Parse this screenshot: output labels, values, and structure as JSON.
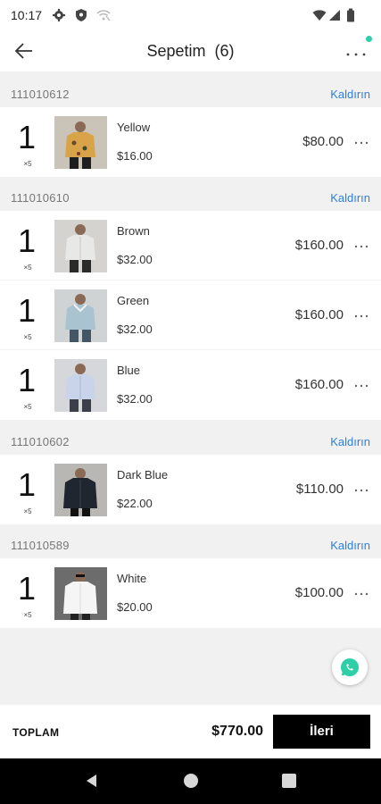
{
  "status_bar": {
    "time": "10:17",
    "icons_left": [
      "gear-icon",
      "shield-icon",
      "wifi-off-icon"
    ],
    "icons_right": [
      "wifi-icon",
      "signal-icon",
      "battery-icon"
    ]
  },
  "header": {
    "title": "Sepetim",
    "count": "(6)",
    "notification_color": "#2ecfa8"
  },
  "colors": {
    "accent_link": "#2f7fe0",
    "button_bg": "#000000",
    "background": "#f1f1f1"
  },
  "groups": [
    {
      "code": "111010612",
      "remove_label": "Kaldırın",
      "items": [
        {
          "qty": "1",
          "qty_sub": "×5",
          "name": "Yellow",
          "unit_price": "$16.00",
          "total": "$80.00",
          "shirt_color": "#d9a34a"
        }
      ]
    },
    {
      "code": "111010610",
      "remove_label": "Kaldırın",
      "items": [
        {
          "qty": "1",
          "qty_sub": "×5",
          "name": "Brown",
          "unit_price": "$32.00",
          "total": "$160.00",
          "shirt_color": "#e8e8e6"
        },
        {
          "qty": "1",
          "qty_sub": "×5",
          "name": "Green",
          "unit_price": "$32.00",
          "total": "$160.00",
          "shirt_color": "#a9c3d0"
        },
        {
          "qty": "1",
          "qty_sub": "×5",
          "name": "Blue",
          "unit_price": "$32.00",
          "total": "$160.00",
          "shirt_color": "#c9d4ea"
        }
      ]
    },
    {
      "code": "111010602",
      "remove_label": "Kaldırın",
      "items": [
        {
          "qty": "1",
          "qty_sub": "×5",
          "name": "Dark Blue",
          "unit_price": "$22.00",
          "total": "$110.00",
          "shirt_color": "#202630"
        }
      ]
    },
    {
      "code": "111010589",
      "remove_label": "Kaldırın",
      "items": [
        {
          "qty": "1",
          "qty_sub": "×5",
          "name": "White",
          "unit_price": "$20.00",
          "total": "$100.00",
          "shirt_color": "#f5f5f5"
        }
      ]
    }
  ],
  "footer": {
    "total_label": "TOPLAM",
    "total_amount": "$770.00",
    "next_label": "İleri"
  },
  "support_button": {
    "icon": "whatsapp-chat-icon",
    "color": "#2ecfa8"
  },
  "nav_bar": {
    "icons": [
      "back-triangle-icon",
      "home-circle-icon",
      "recents-square-icon"
    ]
  }
}
